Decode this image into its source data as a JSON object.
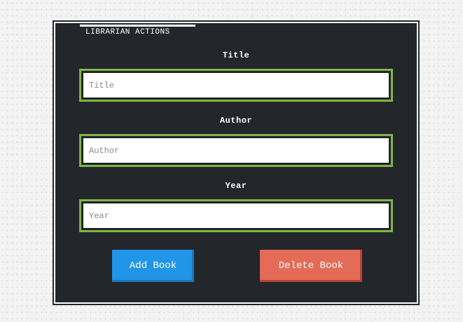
{
  "panel": {
    "legend": "LIBRARIAN ACTIONS"
  },
  "fields": {
    "title": {
      "label": "Title",
      "placeholder": "Title",
      "value": ""
    },
    "author": {
      "label": "Author",
      "placeholder": "Author",
      "value": ""
    },
    "year": {
      "label": "Year",
      "placeholder": "Year",
      "value": ""
    }
  },
  "buttons": {
    "add_label": "Add Book",
    "delete_label": "Delete Book"
  },
  "colors": {
    "panel_bg": "#23262b",
    "field_border": "#7fb544",
    "add_button": "#2196e8",
    "delete_button": "#e36b57"
  }
}
